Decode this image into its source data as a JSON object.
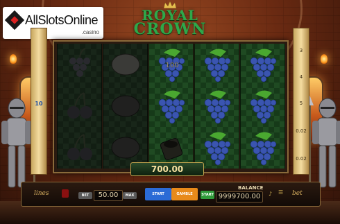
{
  "logo": {
    "text": "AllSlotsOnline",
    "sub": ".casino"
  },
  "title": {
    "line1": "ROYAL",
    "line2": "CROWN"
  },
  "left_lines": {
    "label": "10"
  },
  "right_lines": [
    "3",
    "4",
    "5",
    "0.02",
    "0.02"
  ],
  "reels": [
    [
      "plum",
      "cherry",
      "cherry"
    ],
    [
      "lemon",
      "lemon",
      "lemon"
    ],
    [
      "grapes-100",
      "grapes",
      "bucket"
    ],
    [
      "grapes",
      "grapes",
      "grapes"
    ],
    [
      "grapes",
      "grapes",
      "grapes"
    ]
  ],
  "win": "700.00",
  "controls": {
    "lines_label": "lines",
    "bet_value": "50.00",
    "bet_btn": "BET",
    "max_btn": "MAX",
    "auto_btn": "START",
    "gamble_btn": "GAMBLE",
    "start_btn": "START",
    "balance_label": "BALANCE",
    "balance": "9999700.00",
    "bet_label": "bet"
  },
  "colors": {
    "reel_green": "#1f4a22",
    "gold": "#c8a850",
    "title_green": "#2fa84a",
    "balance_btn": "#2f9a3a",
    "auto_blue": "#2b6bd6",
    "gamble_orange": "#e88a1a"
  }
}
